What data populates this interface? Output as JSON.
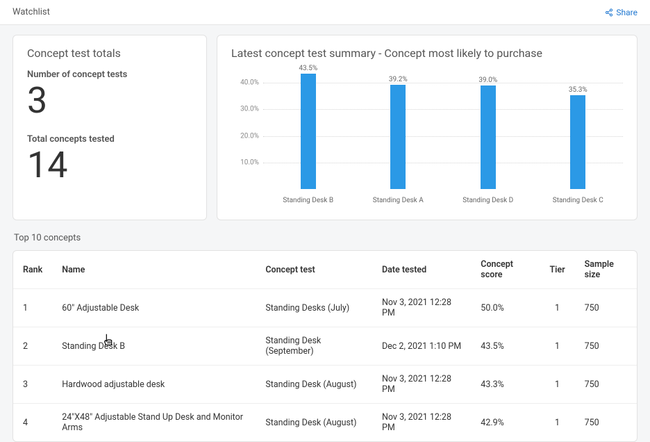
{
  "header": {
    "title": "Watchlist",
    "share_label": "Share"
  },
  "totals_card": {
    "title": "Concept test totals",
    "metric1_label": "Number of concept tests",
    "metric1_value": "3",
    "metric2_label": "Total concepts tested",
    "metric2_value": "14"
  },
  "chart_card": {
    "title": "Latest concept test summary - Concept most likely to purchase"
  },
  "chart_data": {
    "type": "bar",
    "categories": [
      "Standing Desk B",
      "Standing Desk A",
      "Standing Desk D",
      "Standing Desk C"
    ],
    "values": [
      43.5,
      39.2,
      39.0,
      35.3
    ],
    "value_labels": [
      "43.5%",
      "39.2%",
      "39.0%",
      "35.3%"
    ],
    "yticks": [
      10.0,
      20.0,
      30.0,
      40.0
    ],
    "ytick_labels": [
      "10.0%",
      "20.0%",
      "30.0%",
      "40.0%"
    ],
    "ylim": [
      0,
      45
    ],
    "title": "Latest concept test summary - Concept most likely to purchase",
    "xlabel": "",
    "ylabel": ""
  },
  "table": {
    "section_title": "Top 10 concepts",
    "headers": {
      "rank": "Rank",
      "name": "Name",
      "test": "Concept test",
      "date": "Date tested",
      "score": "Concept score",
      "tier": "Tier",
      "sample": "Sample size"
    },
    "rows": [
      {
        "rank": "1",
        "name": "60\" Adjustable Desk",
        "test": "Standing Desks (July)",
        "date": "Nov 3, 2021 12:28 PM",
        "score": "50.0%",
        "tier": "1",
        "sample": "750"
      },
      {
        "rank": "2",
        "name": "Standing Desk B",
        "test": "Standing Desk (September)",
        "date": "Dec 2, 2021 1:10 PM",
        "score": "43.5%",
        "tier": "1",
        "sample": "750"
      },
      {
        "rank": "3",
        "name": "Hardwood adjustable desk",
        "test": "Standing Desk (August)",
        "date": "Nov 3, 2021 12:28 PM",
        "score": "43.3%",
        "tier": "1",
        "sample": "750"
      },
      {
        "rank": "4",
        "name": "24\"X48\" Adjustable Stand Up Desk and Monitor Arms",
        "test": "Standing Desk (August)",
        "date": "Nov 3, 2021 12:28 PM",
        "score": "42.9%",
        "tier": "1",
        "sample": "750"
      }
    ]
  }
}
